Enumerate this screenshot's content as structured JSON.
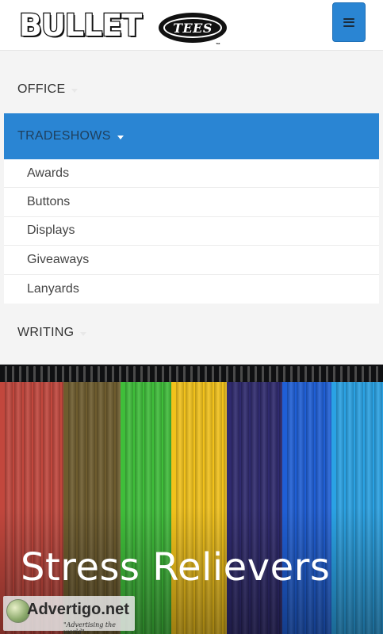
{
  "header": {
    "logo_main": "BULLET",
    "logo_sub": "TEES",
    "logo_tm": "™",
    "menu_icon": "hamburger-icon",
    "accent": "#2a85d3"
  },
  "nav": {
    "office": "OFFICE",
    "tradeshows": "TRADESHOWS",
    "writing": "WRITING",
    "tradeshows_sub": [
      "Awards",
      "Buttons",
      "Displays",
      "Giveaways",
      "Lanyards"
    ],
    "active_bg": "#2a85d3"
  },
  "hero": {
    "title": "Stress Relievers",
    "shirt_colors": [
      "#c2473d",
      "#6e5c2e",
      "#3fbe3a",
      "#f2c21b",
      "#2f2a6e",
      "#1f5fd6",
      "#2aa2e4"
    ]
  },
  "watermark": {
    "text": "Advertigo.net",
    "tagline": "\"Advertising the world\""
  }
}
